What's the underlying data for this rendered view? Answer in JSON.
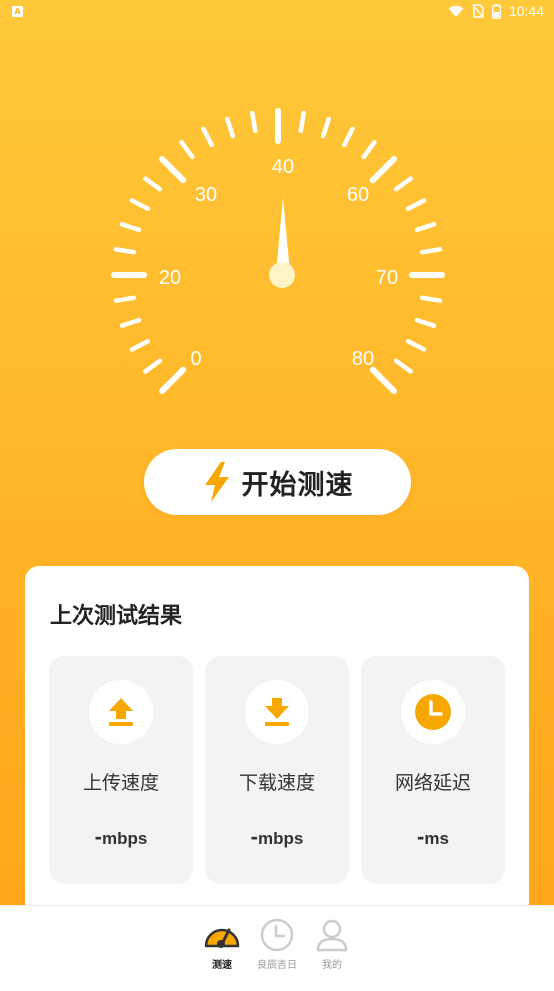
{
  "status_bar": {
    "app_icon_letter": "A",
    "time": "10:44"
  },
  "gauge": {
    "tick_labels": [
      "0",
      "20",
      "30",
      "40",
      "60",
      "70",
      "80"
    ],
    "needle_value": 40
  },
  "start_button": {
    "label": "开始测速",
    "icon": "lightning-bolt-icon"
  },
  "last_result": {
    "title": "上次测试结果",
    "items": [
      {
        "label": "上传速度",
        "value": "-",
        "unit": "mbps",
        "icon": "upload-icon"
      },
      {
        "label": "下载速度",
        "value": "-",
        "unit": "mbps",
        "icon": "download-icon"
      },
      {
        "label": "网络延迟",
        "value": "-",
        "unit": "ms",
        "icon": "clock-icon"
      }
    ]
  },
  "bottom_nav": {
    "items": [
      {
        "label": "测速",
        "icon": "speedometer-icon",
        "active": true
      },
      {
        "label": "良辰吉日",
        "icon": "clock-icon",
        "active": false
      },
      {
        "label": "我的",
        "icon": "user-icon",
        "active": false
      }
    ]
  },
  "colors": {
    "accent": "#ffb52a",
    "accent_dark": "#f5a300",
    "white": "#ffffff"
  }
}
